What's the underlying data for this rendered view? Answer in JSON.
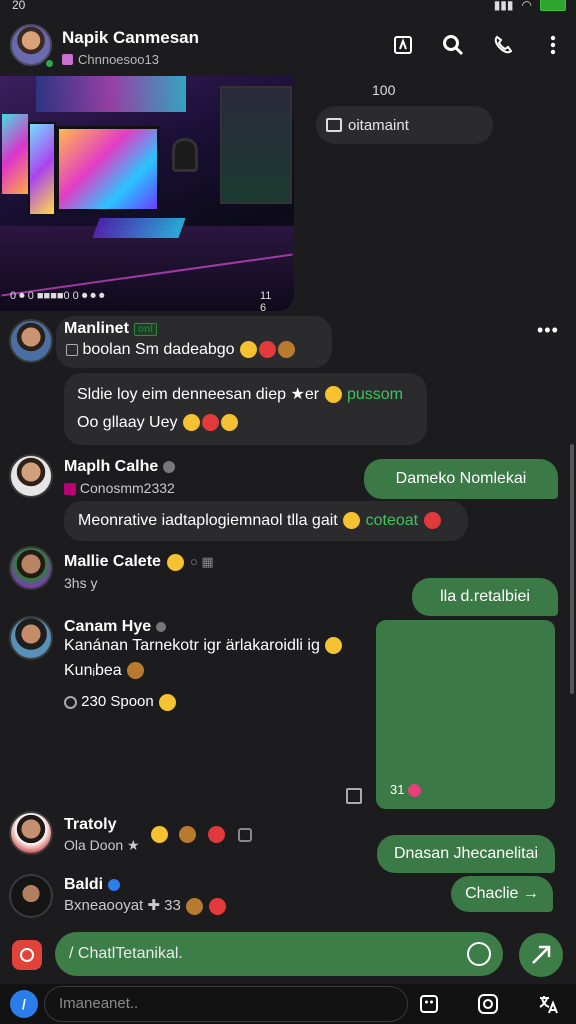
{
  "status_bar": {
    "time": "20",
    "battery": ""
  },
  "header": {
    "title": "Napik Canmesan",
    "subtitle": "Chnnoesoo13",
    "actions": [
      "flag-icon",
      "search-icon",
      "phone-icon",
      "more-vert-icon"
    ]
  },
  "chat": {
    "time_label": "100",
    "media": {
      "caption": "0 ⏺ 0 ■■■■0 0 ⏺ ⏺ ⏺",
      "count": "11 6"
    },
    "system_pill": "oitamaint",
    "messages": [
      {
        "name": "Manlinet",
        "name_tag": "onl",
        "text": "boolan Sm dadeabgo",
        "more": "•••"
      },
      {
        "line1": "Sldie loy eim denneesan diep ★er",
        "line1_green": "pussom",
        "line2": "Oo gllaay Uey"
      },
      {
        "name": "Maplh Calhe",
        "sub": "Conosmm2332",
        "text": "Meonrative iadtaplogiemnaol tlla gait",
        "green": "coteoat"
      },
      {
        "name": "Mallie Calete",
        "sub": "3hs y"
      },
      {
        "name": "Canam Hye",
        "line1": "Kanánan Tarnekotr igr ärlakaroidli ig",
        "line2": "Kunᵢbea",
        "line3": "230 Spoon"
      },
      {
        "name": "Tratoly",
        "sub": "Ola Doon ★"
      },
      {
        "name": "Baldi",
        "sub": "Bxneaooyat ✚ 33"
      }
    ],
    "outgoing": [
      "Dameko Nomlekai",
      "lla d.retalbiei",
      "Dnasan Jhecanelitai",
      "Chaclie →"
    ],
    "green_card_caption": "31"
  },
  "composer": {
    "placeholder": "/ ChatlTetanikal."
  },
  "bottombar": {
    "search_placeholder": "Imaneanet..",
    "icons": [
      "sticker-icon",
      "instagram-icon",
      "translate-icon"
    ]
  },
  "colors": {
    "background": "#1c1c1e",
    "bubble_in": "#2b2b2d",
    "bubble_out": "#3b7a46",
    "accent_green": "#3dc45c",
    "camera_red": "#e0433a"
  }
}
